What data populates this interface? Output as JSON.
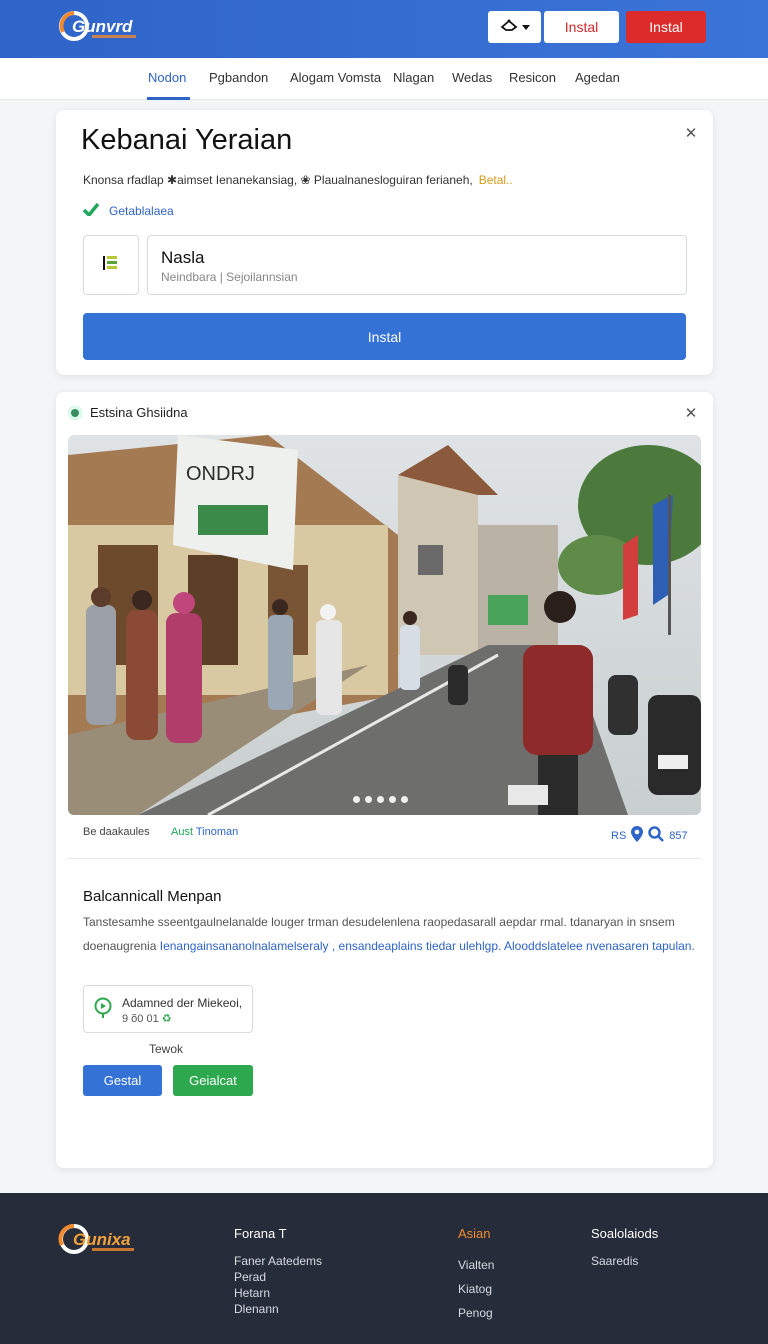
{
  "header": {
    "logo_text": "Gunvrd",
    "btn_outline": "Instal",
    "btn_primary": "Instal"
  },
  "nav": {
    "items": [
      "Nodon",
      "Pgbandon",
      "Alogam Vomsta",
      "Nlagan",
      "Wedas",
      "Resicon",
      "Agedan"
    ]
  },
  "install_card": {
    "title": "Kebanai Yeraian",
    "description": "Knonsa rfadlap ✱aimset Ienanekansiag, ❀ Plaualnanesloguiran ferianeh,",
    "more": "Betal..",
    "check_label": "Getablalaea",
    "field_label": "Nasla",
    "field_placeholder": "Neindbara | Sejoilannsian",
    "button": "Instal"
  },
  "post_card": {
    "head": "Estsina Ghsiidna",
    "meta_left": "Be daakaules",
    "meta_tag_prefix": "Aust",
    "meta_tag": "Tinoman",
    "meta_right_prefix": "RS",
    "meta_right_value": "857",
    "subtitle": "Balcannicall Menpan",
    "body_line1": "Tanstesamhe sseentgaulnelanalde louger trman desudelenlena raopedasarall aepdar rmal. tdanaryan in snsem",
    "body_line2_prefix": "doenaugrenia",
    "body_line2_highlight": "Ienangainsananolnalamelseraly , ensandeaplains tiedar ulehlgp. Alooddslatelee nvenasaren tapulan.",
    "info_title": "Adamned der Miekeoi,",
    "info_sub": "9  õ0  01",
    "small_label": "Tewok",
    "btn_blue": "Gestal",
    "btn_green": "Geialcat"
  },
  "footer": {
    "logo_text": "Gunixa",
    "col1_head": "Forana T",
    "col1_links": [
      "Faner Aatedems",
      "Perad",
      "Hetarn",
      "Dlenann"
    ],
    "col2_head": "Asian",
    "col2_links": [
      "Vialten",
      "Kiatog",
      "Penog"
    ],
    "col3_head": "Soalolaiods",
    "col3_links": [
      "Saaredis"
    ]
  },
  "colors": {
    "brand_blue": "#3472d6",
    "danger_red": "#db2b2b",
    "success_green": "#2ea84e",
    "footer_bg": "#272c3a",
    "accent_orange": "#f08a2c"
  },
  "icons": [
    "logo-mark",
    "translate-icon",
    "chevron-down-icon",
    "close-icon",
    "check-icon",
    "barcode-icon",
    "status-dot-icon",
    "map-pin-icon",
    "search-icon",
    "location-icon"
  ]
}
